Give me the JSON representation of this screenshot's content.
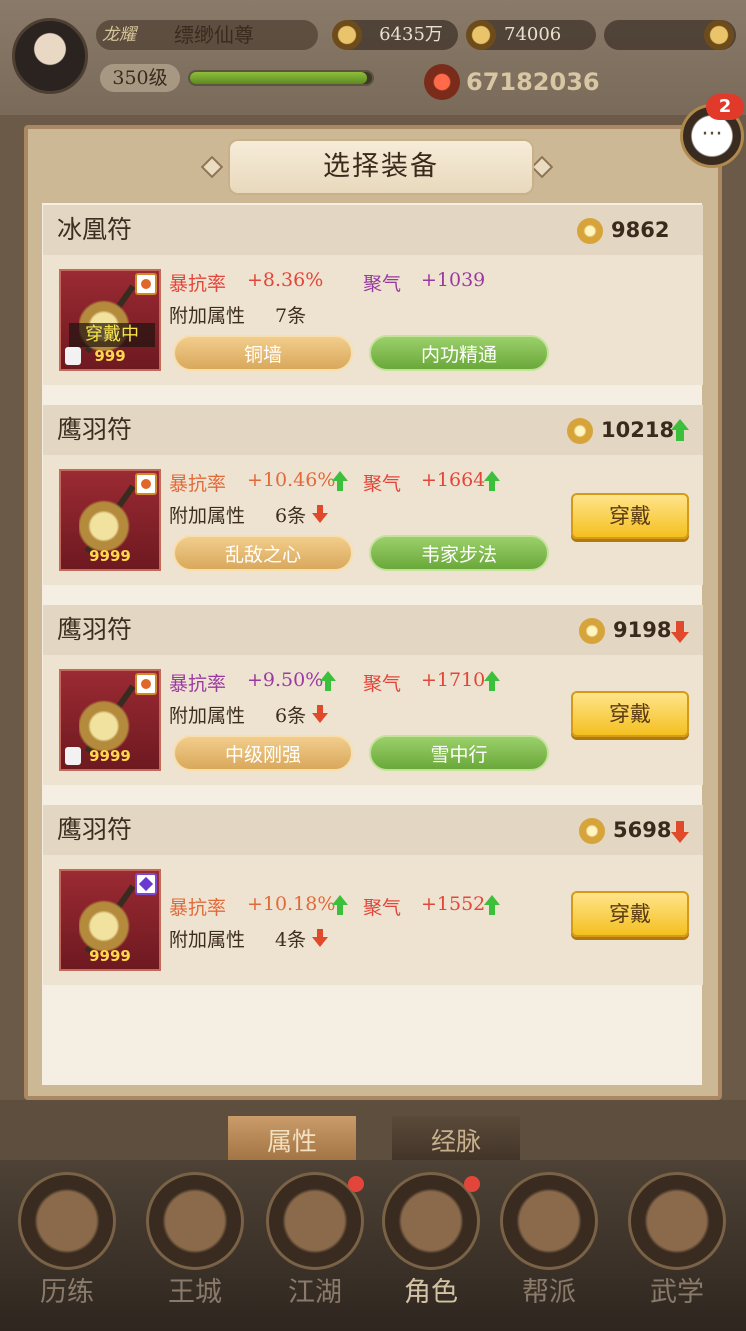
{
  "header": {
    "vip": "龙耀",
    "player_name": "缥缈仙尊",
    "level": "350级",
    "exp_fraction": 0.97,
    "currency1": "6435万",
    "currency2": "74006",
    "power": "67182036"
  },
  "chat": {
    "badge_count": "2",
    "dots": "···"
  },
  "dialog": {
    "title": "选择装备",
    "cards": [
      {
        "name": "冰凰符",
        "score": "9862",
        "score_trend": "none",
        "equipped": true,
        "equipped_label": "穿戴中",
        "locked": true,
        "count": "999",
        "stat1_label": "暴抗率",
        "stat1_value": "+8.36%",
        "stat1_trend": "none",
        "stat2_label": "聚气",
        "stat2_value": "+1039",
        "stat2_trend": "none",
        "extra_label": "附加属性",
        "extra_value": "7条",
        "extra_trend": "none",
        "skills": [
          "铜墙",
          "内功精通"
        ]
      },
      {
        "name": "鹰羽符",
        "score": "10218",
        "score_trend": "up",
        "equipped": false,
        "locked": false,
        "count": "9999",
        "stat1_label": "暴抗率",
        "stat1_value": "+10.46%",
        "stat1_trend": "up",
        "stat2_label": "聚气",
        "stat2_value": "+1664",
        "stat2_trend": "up",
        "extra_label": "附加属性",
        "extra_value": "6条",
        "extra_trend": "down",
        "skills": [
          "乱敌之心",
          "韦家步法"
        ],
        "button": "穿戴"
      },
      {
        "name": "鹰羽符",
        "score": "9198",
        "score_trend": "down",
        "equipped": false,
        "locked": true,
        "count": "9999",
        "stat1_label": "暴抗率",
        "stat1_value": "+9.50%",
        "stat1_trend": "up",
        "stat2_label": "聚气",
        "stat2_value": "+1710",
        "stat2_trend": "up",
        "extra_label": "附加属性",
        "extra_value": "6条",
        "extra_trend": "down",
        "skills": [
          "中级刚强",
          "雪中行"
        ],
        "button": "穿戴"
      },
      {
        "name": "鹰羽符",
        "score": "5698",
        "score_trend": "down",
        "equipped": false,
        "locked": false,
        "count": "9999",
        "stat1_label": "暴抗率",
        "stat1_value": "+10.18%",
        "stat1_trend": "up",
        "stat2_label": "聚气",
        "stat2_value": "+1552",
        "stat2_trend": "up",
        "extra_label": "附加属性",
        "extra_value": "4条",
        "extra_trend": "down",
        "skills": [],
        "button": "穿戴"
      }
    ]
  },
  "bottom_tabs": {
    "attributes": "属性",
    "meridians": "经脉"
  },
  "nav": [
    {
      "label": "历练",
      "dot": false
    },
    {
      "label": "王城",
      "dot": false
    },
    {
      "label": "江湖",
      "dot": true
    },
    {
      "label": "角色",
      "dot": true,
      "active": true
    },
    {
      "label": "帮派",
      "dot": false
    },
    {
      "label": "武学",
      "dot": false
    }
  ]
}
